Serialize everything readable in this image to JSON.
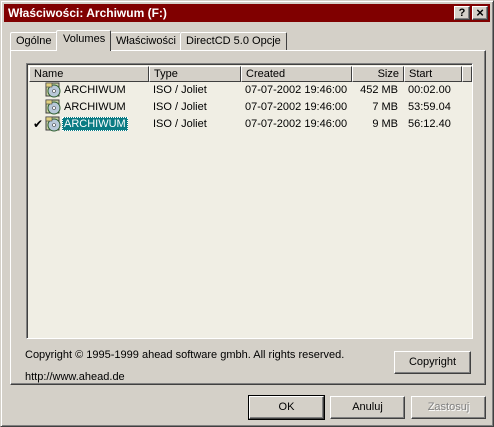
{
  "window": {
    "title": "Właściwości: Archiwum (F:)",
    "help_button": "?",
    "close_button": "×"
  },
  "tabs": [
    {
      "label": "Ogólne",
      "active": false
    },
    {
      "label": "Volumes",
      "active": true
    },
    {
      "label": "Właściwości",
      "active": false
    },
    {
      "label": "DirectCD 5.0 Opcje",
      "active": false
    }
  ],
  "volumes": {
    "columns": [
      "Name",
      "Type",
      "Created",
      "Size",
      "Start"
    ],
    "rows": [
      {
        "check": "",
        "name": "ARCHIWUM",
        "type": "ISO / Joliet",
        "created": "07-07-2002 19:46:00",
        "size": "452 MB",
        "start": "00:02.00",
        "selected": false
      },
      {
        "check": "",
        "name": "ARCHIWUM",
        "type": "ISO / Joliet",
        "created": "07-07-2002 19:46:00",
        "size": "7 MB",
        "start": "53:59.04",
        "selected": false
      },
      {
        "check": "✔",
        "name": "ARCHIWUM",
        "type": "ISO / Joliet",
        "created": "07-07-2002 19:46:00",
        "size": "9 MB",
        "start": "56:12.40",
        "selected": true
      }
    ],
    "row_icon": "cd-disc-icon"
  },
  "footer": {
    "copyright_text": "Copyright © 1995-1999 ahead software gmbh. All rights reserved.",
    "url": "http://www.ahead.de",
    "copyright_button": "Copyright"
  },
  "buttons": {
    "ok": "OK",
    "cancel": "Anuluj",
    "apply": "Zastosuj"
  },
  "colors": {
    "titlebar": "#800000",
    "selection": "#0a7b83",
    "face": "#d4d0c8"
  }
}
